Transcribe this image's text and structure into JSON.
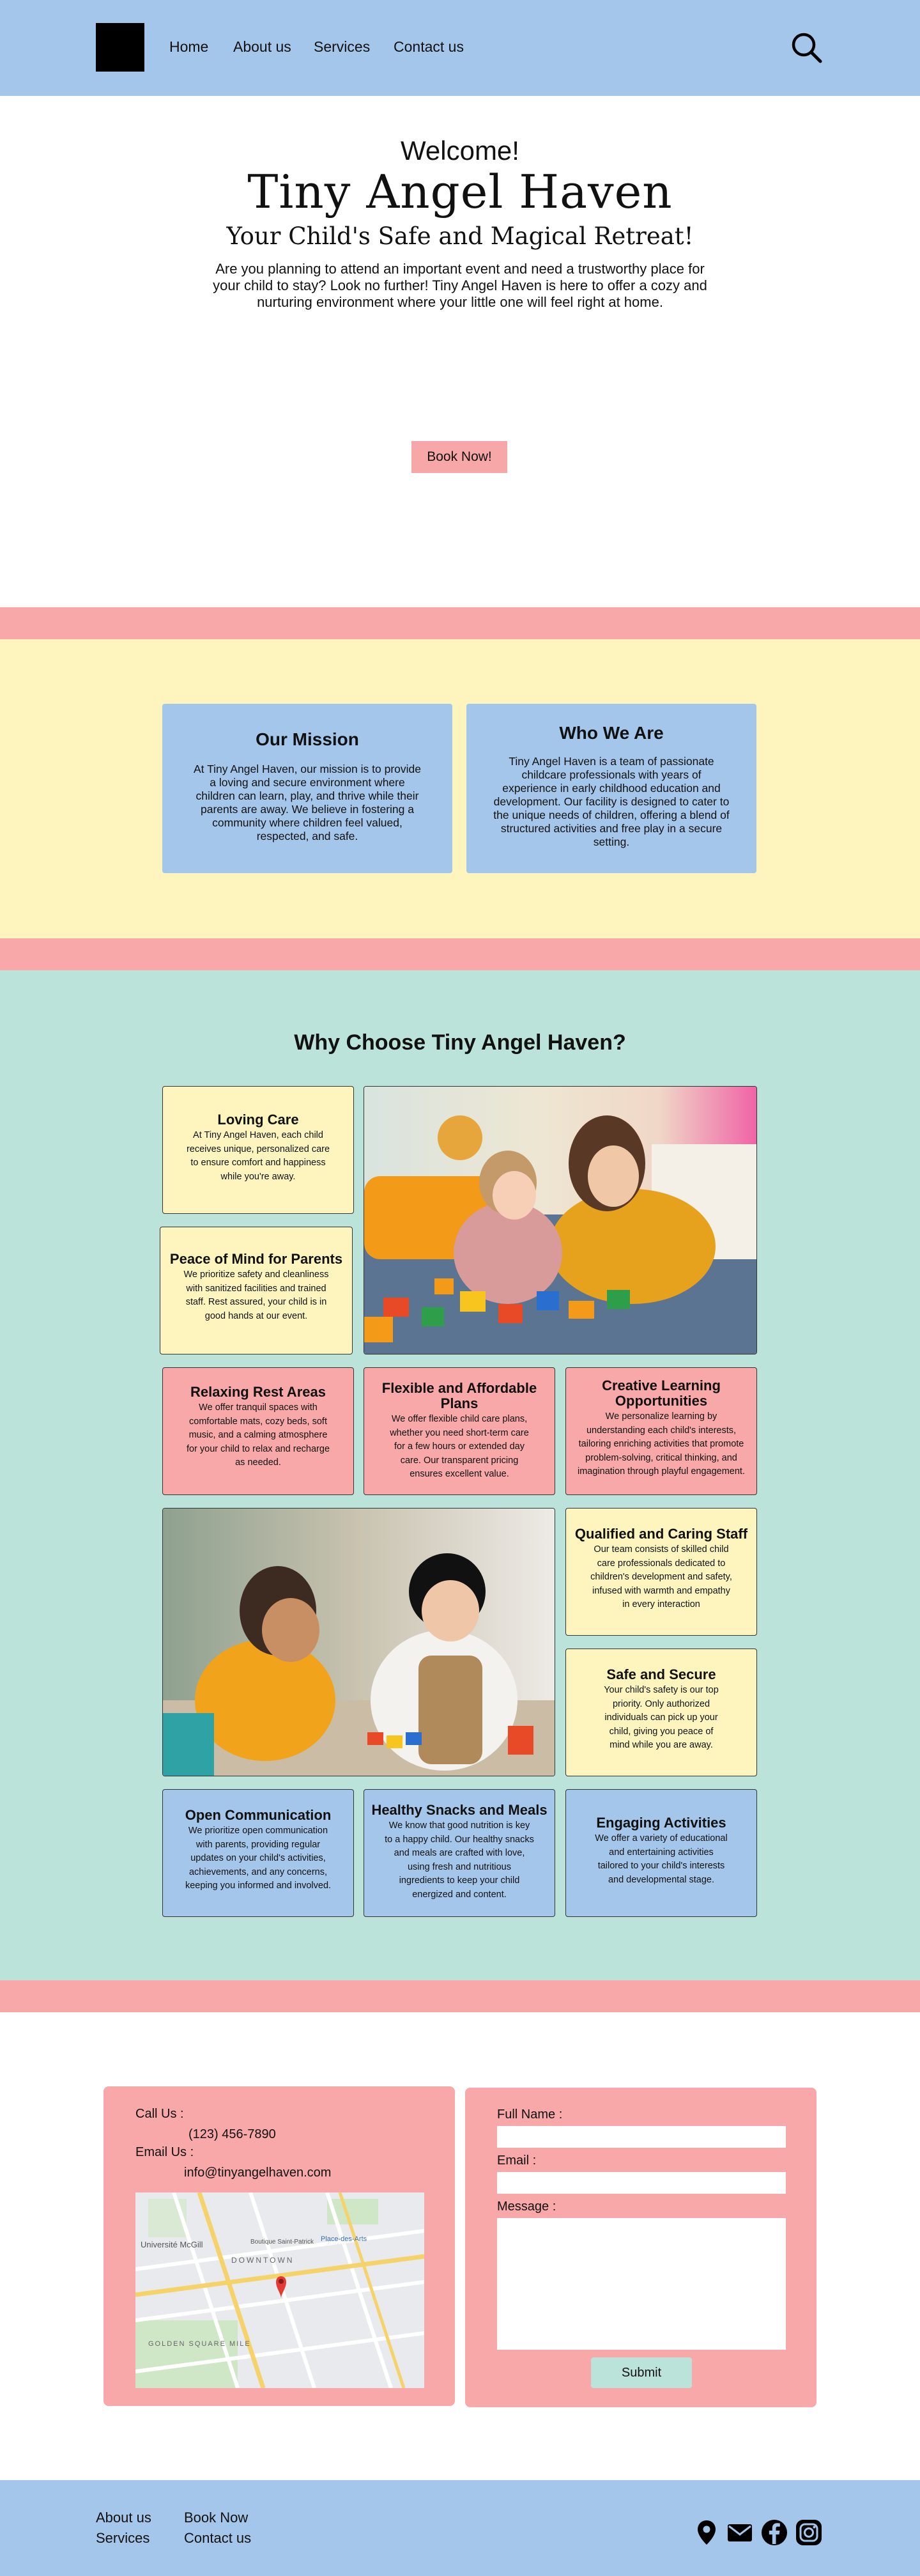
{
  "nav": {
    "links": [
      "Home",
      "About us",
      "Services",
      "Contact us"
    ]
  },
  "hero": {
    "welcome": "Welcome!",
    "title": "Tiny Angel Haven",
    "subtitle": "Your Child's Safe and Magical Retreat!",
    "description": "Are you planning to attend an important event and need a trustworthy place for your child to stay? Look no further! Tiny Angel Haven is here to offer a cozy and nurturing environment where your little one will feel right at home.",
    "button": "Book Now!"
  },
  "about": {
    "mission_title": "Our Mission",
    "mission_text": "At Tiny Angel Haven, our mission is to provide a loving and secure environment where children can learn, play, and thrive while their parents are away. We believe in fostering a community where children feel valued, respected, and safe.",
    "who_title": "Who We Are",
    "who_text": "Tiny Angel Haven is a team of passionate childcare professionals with years of experience in early childhood education and development. Our facility is designed to cater to the unique needs of children, offering a blend of structured activities and free play in a secure setting."
  },
  "why": {
    "title": "Why Choose Tiny Angel Haven?",
    "features": [
      {
        "title": "Loving Care",
        "text": "At Tiny Angel Haven, each child receives unique, personalized care to ensure comfort and happiness while you're away."
      },
      {
        "title": "Peace of Mind for Parents",
        "text": "We prioritize safety and cleanliness with sanitized facilities and trained staff. Rest assured, your child is in good hands at our event."
      },
      {
        "title": "Relaxing Rest Areas",
        "text": "We offer tranquil spaces with comfortable mats, cozy beds, soft music, and a calming atmosphere for your child to relax and recharge as needed."
      },
      {
        "title": "Flexible and Affordable Plans",
        "text": "We offer flexible child care plans, whether you need short-term care for a few hours or extended day care. Our transparent pricing ensures excellent value."
      },
      {
        "title": "Creative Learning Opportunities",
        "text": "We personalize learning by understanding each child's interests, tailoring enriching activities that promote problem-solving, critical thinking, and imagination through playful engagement."
      },
      {
        "title": "Qualified and Caring Staff",
        "text": "Our team consists of skilled child care professionals dedicated to children's development and safety, infused with warmth and empathy in every interaction"
      },
      {
        "title": "Safe and Secure",
        "text": "Your child's safety is our top priority. Only authorized individuals can pick up your child, giving you peace of mind while you are away."
      },
      {
        "title": "Open Communication",
        "text": "We prioritize open communication with parents, providing regular updates on your child's activities, achievements, and any concerns, keeping you informed and involved."
      },
      {
        "title": "Healthy Snacks and Meals",
        "text": "We know that good nutrition is key to a happy child. Our healthy snacks and meals are crafted with love, using fresh and nutritious ingredients to keep your child energized and content."
      },
      {
        "title": "Engaging Activities",
        "text": "We offer a variety of educational and entertaining activities tailored to your child's interests and developmental stage."
      }
    ]
  },
  "contact": {
    "call_label": "Call Us :",
    "phone": "(123) 456-7890",
    "email_label": "Email Us :",
    "email": "info@tinyangelhaven.com",
    "map_labels": [
      "Université McGill",
      "DOWNTOWN",
      "GOLDEN SQUARE MILE",
      "Place-des-Arts",
      "Boutique Saint-Patrick"
    ],
    "form": {
      "name_label": "Full Name :",
      "email_label": "Email :",
      "message_label": "Message :",
      "submit": "Submit"
    }
  },
  "footer": {
    "links": [
      "About us",
      "Services",
      "Book Now",
      "Contact us"
    ],
    "icons": [
      "location-pin-icon",
      "mail-icon",
      "facebook-icon",
      "instagram-icon"
    ]
  },
  "colors": {
    "nav_blue": "#a4c6ea",
    "pink": "#f8a8a8",
    "yellow": "#fdf5bd",
    "mint": "#bbe3d9"
  }
}
